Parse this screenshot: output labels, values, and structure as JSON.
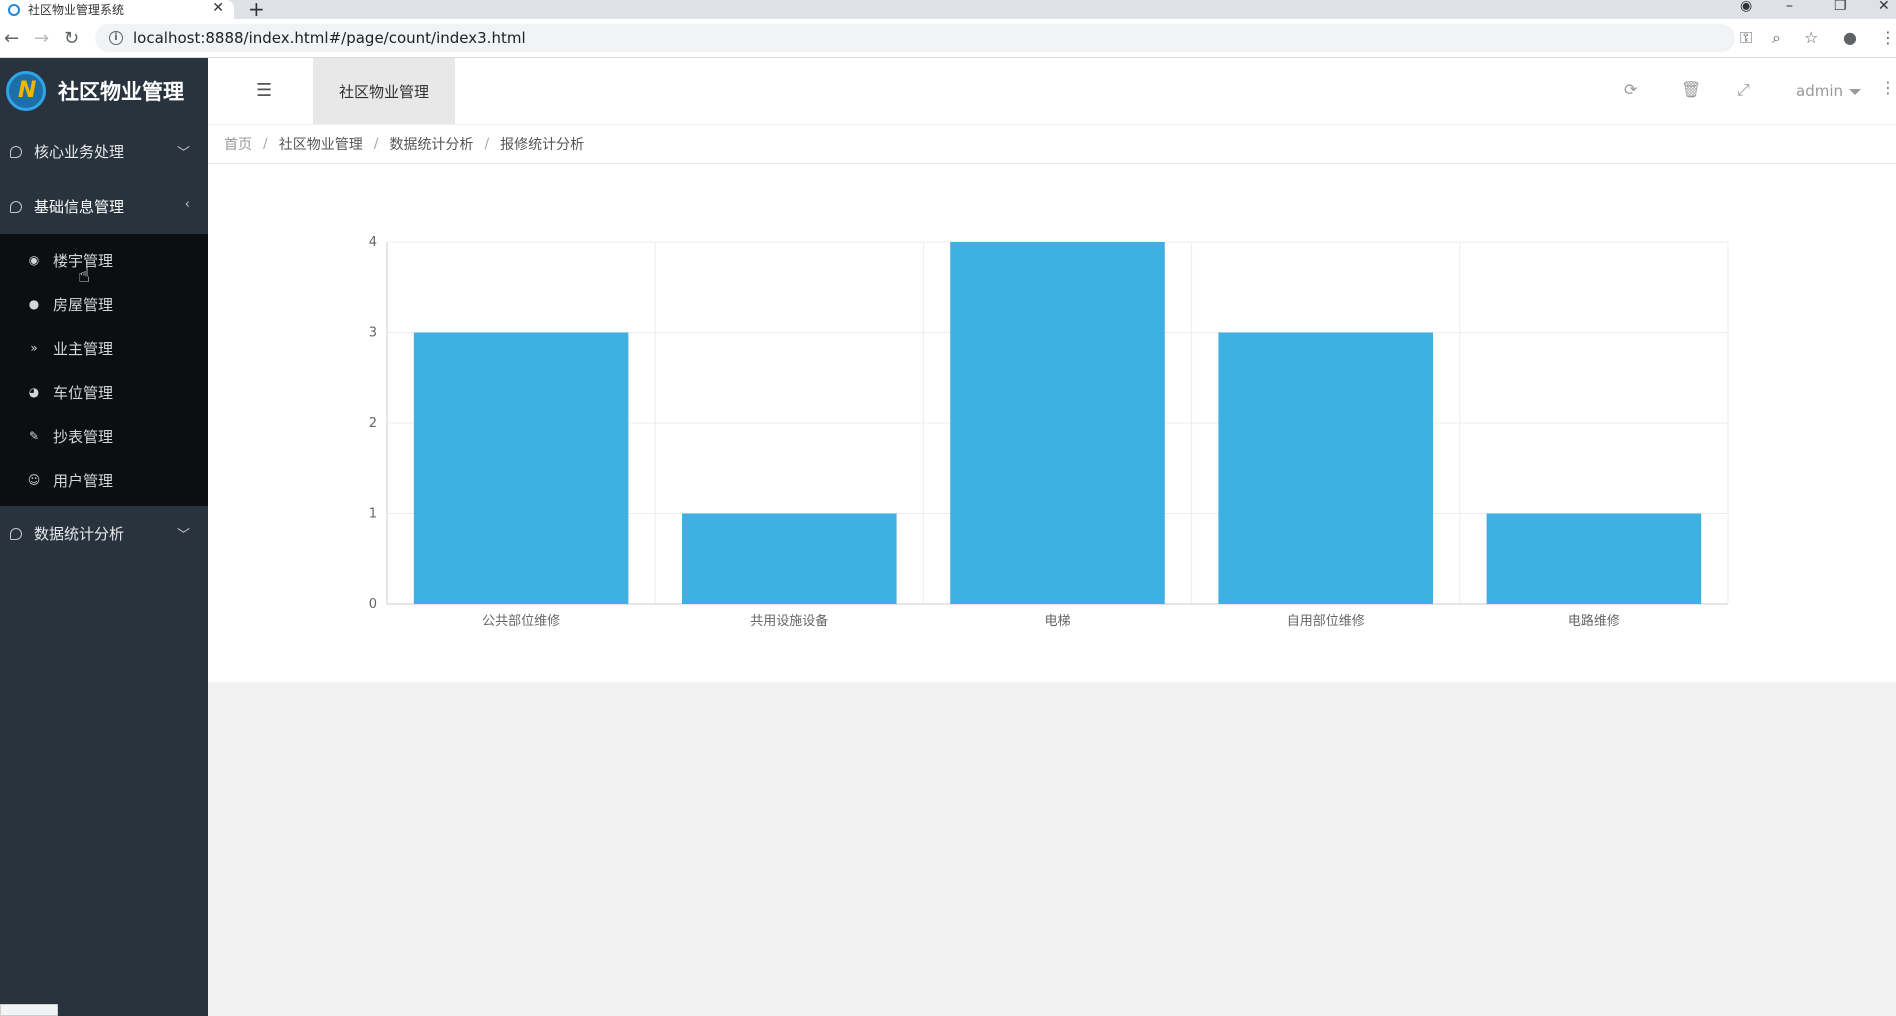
{
  "browser": {
    "tab_title": "社区物业管理系统",
    "url": "localhost:8888/index.html#/page/count/index3.html"
  },
  "sidebar": {
    "brand": "社区物业管理",
    "menus": [
      {
        "label": "核心业务处理"
      },
      {
        "label": "基础信息管理"
      },
      {
        "label": "数据统计分析"
      }
    ],
    "submenu": [
      {
        "label": "楼宇管理",
        "icon": "target-circle-icon"
      },
      {
        "label": "房屋管理",
        "icon": "compass-icon"
      },
      {
        "label": "业主管理",
        "icon": "double-chevron-down-icon"
      },
      {
        "label": "车位管理",
        "icon": "dashboard-icon"
      },
      {
        "label": "抄表管理",
        "icon": "edit-icon"
      },
      {
        "label": "用户管理",
        "icon": "user-circle-icon"
      }
    ]
  },
  "header": {
    "active_tab": "社区物业管理",
    "user": "admin"
  },
  "breadcrumb": [
    "首页",
    "社区物业管理",
    "数据统计分析",
    "报修统计分析"
  ],
  "chart_data": {
    "type": "bar",
    "categories": [
      "公共部位维修",
      "共用设施设备",
      "电梯",
      "自用部位维修",
      "电路维修"
    ],
    "values": [
      3,
      1,
      4,
      3,
      1
    ],
    "ylim": [
      0,
      4
    ],
    "yticks": [
      0,
      1,
      2,
      3,
      4
    ],
    "grid": true,
    "bar_color": "#3eb0e2"
  }
}
